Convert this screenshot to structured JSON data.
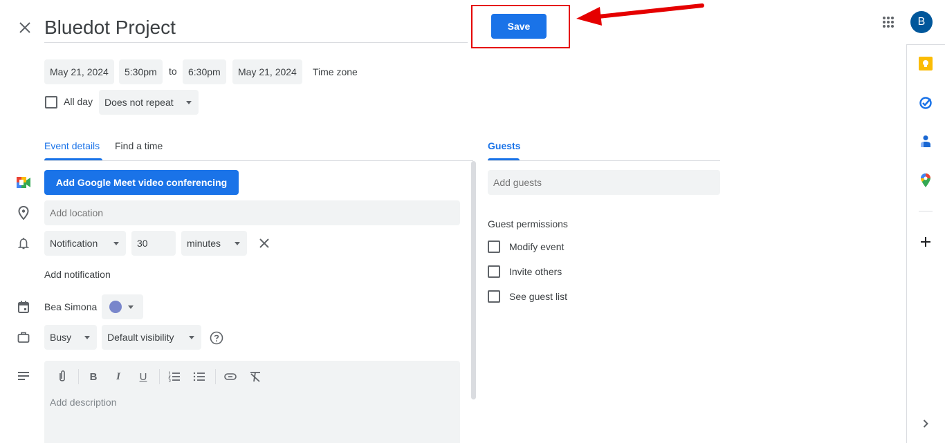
{
  "header": {
    "close_icon": "close-icon",
    "title": "Bluedot Project",
    "save_label": "Save",
    "apps_icon": "apps-grid-icon",
    "avatar_initial": "B",
    "avatar_color": "#01579b"
  },
  "datetime": {
    "start_date": "May 21, 2024",
    "start_time": "5:30pm",
    "to_label": "to",
    "end_time": "6:30pm",
    "end_date": "May 21, 2024",
    "timezone_label": "Time zone",
    "all_day_label": "All day",
    "all_day_checked": false,
    "repeat_value": "Does not repeat"
  },
  "tabs": {
    "event_details": "Event details",
    "find_a_time": "Find a time",
    "active": "Event details"
  },
  "details": {
    "meet_button": "Add Google Meet video conferencing",
    "location_placeholder": "Add location",
    "notification_type": "Notification",
    "notification_amount": "30",
    "notification_unit": "minutes",
    "add_notification": "Add notification",
    "calendar_owner": "Bea Simona",
    "calendar_color": "#7986cb",
    "availability": "Busy",
    "visibility": "Default visibility",
    "description_placeholder": "Add description",
    "toolbar": [
      "attach-icon",
      "bold-icon",
      "italic-icon",
      "underline-icon",
      "numbered-list-icon",
      "bulleted-list-icon",
      "link-icon",
      "remove-formatting-icon"
    ]
  },
  "guests": {
    "tab_label": "Guests",
    "add_placeholder": "Add guests",
    "permissions_title": "Guest permissions",
    "permissions": [
      {
        "label": "Modify event",
        "checked": false
      },
      {
        "label": "Invite others",
        "checked": false
      },
      {
        "label": "See guest list",
        "checked": false
      }
    ]
  },
  "side_panel": {
    "apps": [
      "keep-icon",
      "tasks-icon",
      "contacts-icon",
      "maps-icon"
    ],
    "add_icon": "add-icon",
    "expand_icon": "chevron-right-icon"
  },
  "colors": {
    "accent": "#1a73e8",
    "annotation": "#e50000"
  }
}
